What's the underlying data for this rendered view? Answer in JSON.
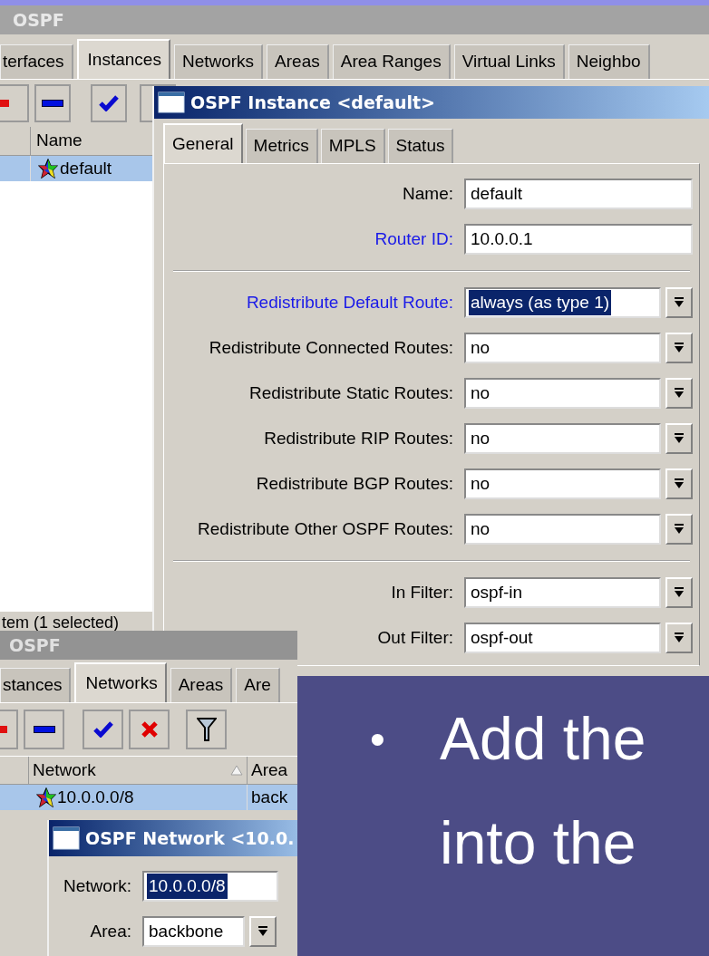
{
  "slide": {
    "bullet": "•",
    "lines": [
      "Add the",
      "into the"
    ]
  },
  "ospf_window": {
    "title": "OSPF",
    "tabs": [
      {
        "label": "terfaces",
        "selected": false
      },
      {
        "label": "Instances",
        "selected": true
      },
      {
        "label": "Networks",
        "selected": false
      },
      {
        "label": "Areas",
        "selected": false
      },
      {
        "label": "Area Ranges",
        "selected": false
      },
      {
        "label": "Virtual Links",
        "selected": false
      },
      {
        "label": "Neighbo",
        "selected": false
      }
    ],
    "columns": [
      "Name"
    ],
    "rows": [
      {
        "name": "default",
        "selected": true
      }
    ],
    "status": "tem (1 selected)"
  },
  "instance_dialog": {
    "title": "OSPF Instance <default>",
    "tabs": [
      {
        "label": "General",
        "selected": true
      },
      {
        "label": "Metrics",
        "selected": false
      },
      {
        "label": "MPLS",
        "selected": false
      },
      {
        "label": "Status",
        "selected": false
      }
    ],
    "groups": [
      [
        {
          "label": "Name:",
          "value": "default",
          "kind": "text",
          "modified": false,
          "value_selected": false
        },
        {
          "label": "Router ID:",
          "value": "10.0.0.1",
          "kind": "text",
          "modified": true,
          "value_selected": false
        }
      ],
      [
        {
          "label": "Redistribute Default Route:",
          "value": "always (as type 1)",
          "kind": "select",
          "modified": true,
          "value_selected": true
        },
        {
          "label": "Redistribute Connected Routes:",
          "value": "no",
          "kind": "select",
          "modified": false,
          "value_selected": false
        },
        {
          "label": "Redistribute Static Routes:",
          "value": "no",
          "kind": "select",
          "modified": false,
          "value_selected": false
        },
        {
          "label": "Redistribute RIP Routes:",
          "value": "no",
          "kind": "select",
          "modified": false,
          "value_selected": false
        },
        {
          "label": "Redistribute BGP Routes:",
          "value": "no",
          "kind": "select",
          "modified": false,
          "value_selected": false
        },
        {
          "label": "Redistribute Other OSPF Routes:",
          "value": "no",
          "kind": "select",
          "modified": false,
          "value_selected": false
        }
      ],
      [
        {
          "label": "In Filter:",
          "value": "ospf-in",
          "kind": "select",
          "modified": false,
          "value_selected": false
        },
        {
          "label": "Out Filter:",
          "value": "ospf-out",
          "kind": "select",
          "modified": false,
          "value_selected": false
        }
      ]
    ]
  },
  "networks_window": {
    "title": "OSPF",
    "tabs": [
      {
        "label": "stances",
        "selected": false
      },
      {
        "label": "Networks",
        "selected": true
      },
      {
        "label": "Areas",
        "selected": false
      },
      {
        "label": "Are",
        "selected": false
      }
    ],
    "columns": [
      {
        "label": "Network",
        "sorted": true
      },
      {
        "label": "Area",
        "sorted": false
      }
    ],
    "rows": [
      {
        "cells": [
          "10.0.0.0/8",
          "back"
        ],
        "selected": true
      }
    ]
  },
  "network_dialog": {
    "title": "OSPF Network <10.0.",
    "fields": [
      {
        "label": "Network:",
        "value": "10.0.0.0/8",
        "kind": "text",
        "modified": false,
        "value_selected": true
      },
      {
        "label": "Area:",
        "value": "backbone",
        "kind": "select",
        "modified": false,
        "value_selected": false
      }
    ]
  }
}
